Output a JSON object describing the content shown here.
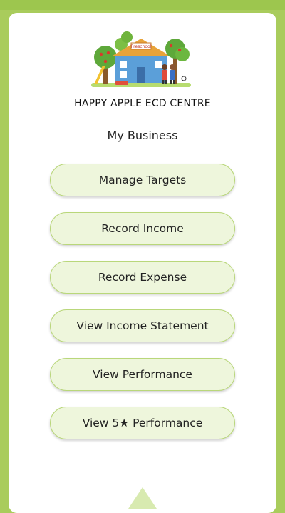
{
  "header": {
    "school_name": "HAPPY APPLE ECD CENTRE",
    "page_title": "My Business",
    "logo_sign_text": "Preschool"
  },
  "menu": {
    "manage_targets": "Manage Targets",
    "record_income": "Record Income",
    "record_expense": "Record Expense",
    "view_income_statement": "View Income Statement",
    "view_performance": "View Performance",
    "view_5star_performance": "View 5★ Performance"
  },
  "colors": {
    "background_frame": "#a9cc5c",
    "button_fill": "#eef6dc",
    "button_border": "#b9d77a"
  }
}
